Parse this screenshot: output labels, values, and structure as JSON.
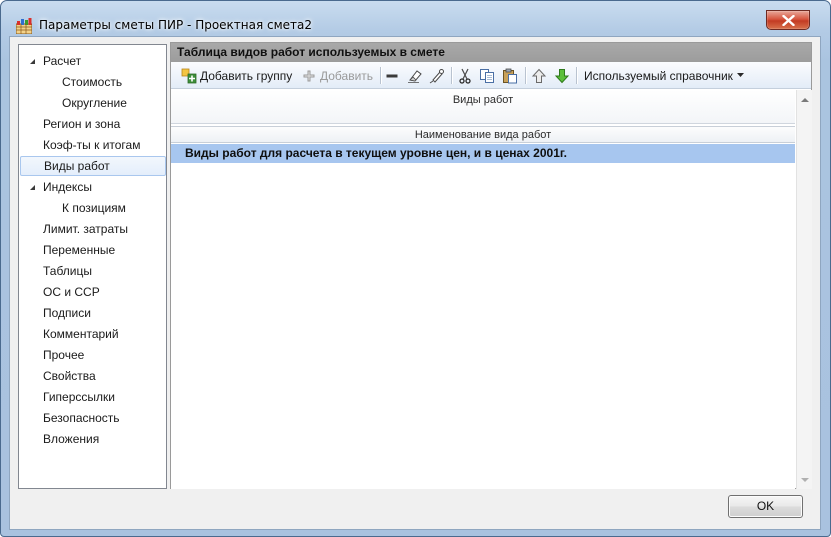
{
  "window": {
    "title": "Параметры сметы ПИР - Проектная смета2",
    "close_icon": "close-icon",
    "app_icon": "app-grid-icon"
  },
  "nav": {
    "items": [
      {
        "label": "Расчет",
        "level": 0,
        "expander": "expanded",
        "selected": false
      },
      {
        "label": "Стоимость",
        "level": 1,
        "selected": false
      },
      {
        "label": "Округление",
        "level": 1,
        "selected": false
      },
      {
        "label": "Регион и зона",
        "level": 0,
        "selected": false
      },
      {
        "label": "Коэф-ты к итогам",
        "level": 0,
        "selected": false
      },
      {
        "label": "Виды работ",
        "level": 0,
        "selected": true
      },
      {
        "label": "Индексы",
        "level": 0,
        "expander": "expanded",
        "selected": false
      },
      {
        "label": "К позициям",
        "level": 1,
        "selected": false
      },
      {
        "label": "Лимит. затраты",
        "level": 0,
        "selected": false
      },
      {
        "label": "Переменные",
        "level": 0,
        "selected": false
      },
      {
        "label": "Таблицы",
        "level": 0,
        "selected": false
      },
      {
        "label": "ОС и ССР",
        "level": 0,
        "selected": false
      },
      {
        "label": "Подписи",
        "level": 0,
        "selected": false
      },
      {
        "label": "Комментарий",
        "level": 0,
        "selected": false
      },
      {
        "label": "Прочее",
        "level": 0,
        "selected": false
      },
      {
        "label": "Свойства",
        "level": 0,
        "selected": false
      },
      {
        "label": "Гиперссылки",
        "level": 0,
        "selected": false
      },
      {
        "label": "Безопасность",
        "level": 0,
        "selected": false
      },
      {
        "label": "Вложения",
        "level": 0,
        "selected": false
      }
    ]
  },
  "panel": {
    "header": "Таблица видов работ используемых в смете",
    "toolbar": {
      "add_group": "Добавить группу",
      "add": "Добавить",
      "reference_dropdown": "Используемый справочник"
    },
    "grid": {
      "band_header": "Виды работ",
      "column_header": "Наименование вида работ",
      "rows": [
        "Виды работ для расчета в текущем уровне цен, и в ценах 2001г."
      ]
    }
  },
  "footer": {
    "ok_label": "OK"
  },
  "colors": {
    "selection": "#a7c6ef",
    "panel_header": "#a4a4a4",
    "window_frame": "#aac4e0"
  }
}
